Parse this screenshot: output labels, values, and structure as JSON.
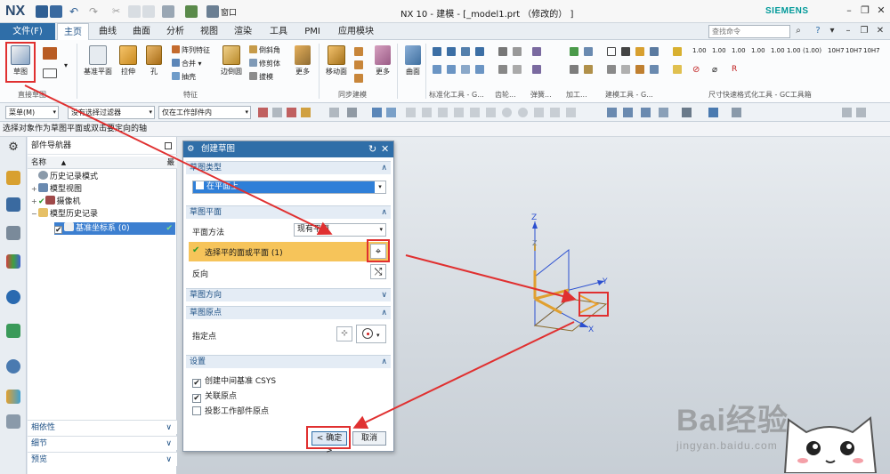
{
  "app": {
    "logo": "NX",
    "window_title": "NX 10 - 建模 - [_model1.prt （修改的） ]",
    "brand": "SIEMENS",
    "brand_color": "#009999",
    "accent_color": "#2f6ea8"
  },
  "quick_access": {
    "window_menu": "窗口"
  },
  "window_buttons": {
    "minimize": "–",
    "restore": "❐",
    "close": "✕"
  },
  "menu": {
    "file": "文件(F)",
    "tabs": [
      "主页",
      "曲线",
      "曲面",
      "分析",
      "视图",
      "渲染",
      "工具",
      "PMI",
      "应用模块"
    ],
    "active_tab": 0,
    "search_placeholder": "查找命令"
  },
  "ribbon": {
    "sketch": "草图",
    "datum_plane": "基准平面",
    "extrude": "拉伸",
    "hole": "孔",
    "pattern_feature": "阵列特征",
    "unite": "合并",
    "shell": "抽壳",
    "edge_blend": "边倒圆",
    "chamfer": "倒斜角",
    "trim_body": "修剪体",
    "draft": "拔模",
    "more": "更多",
    "move_face": "移动面",
    "surface": "曲面",
    "groups": {
      "direct_sketch": "直接草图",
      "feature": "特征",
      "sync_modeling": "同步建模",
      "standard_tools": "标准化工具 - G...",
      "gear": "齿轮...",
      "spring": "弹簧...",
      "machining": "加工...",
      "modeling_tools": "建模工具 - G...",
      "dimension_tools": "尺寸快速格式化工具 - GC工具箱"
    },
    "dim_labels": [
      "1.00",
      "1.00",
      "1.00",
      "1.00",
      "1.00",
      "1.00",
      "(1.00)",
      "10H7",
      "10H7",
      "10H7"
    ]
  },
  "selbar": {
    "menu": "菜单(M)",
    "filter": "没有选择过滤器",
    "scope": "仅在工作部件内"
  },
  "cue": "选择对象作为草图平面或双击要定向的轴",
  "navigator": {
    "title": "部件导航器",
    "columns": {
      "name": "名称",
      "latest": "最"
    },
    "nodes": [
      "历史记录模式",
      "模型视图",
      "摄像机",
      "模型历史记录",
      "基准坐标系 (0)"
    ],
    "bottom_panels": [
      "相依性",
      "细节",
      "预览"
    ]
  },
  "dialog": {
    "title": "创建草图",
    "sketch_type_section": "草图类型",
    "sketch_type_value": "在平面上",
    "sketch_plane_section": "草图平面",
    "plane_method_label": "平面方法",
    "plane_method_value": "现有平面",
    "select_plane": "选择平的面或平面 (1)",
    "reverse": "反向",
    "sketch_orientation_section": "草图方向",
    "sketch_origin_section": "草图原点",
    "specify_point": "指定点",
    "settings_section": "设置",
    "options": [
      {
        "label": "创建中间基准 CSYS",
        "checked": true
      },
      {
        "label": "关联原点",
        "checked": true
      },
      {
        "label": "投影工作部件原点",
        "checked": false
      }
    ],
    "ok": "< 确定 >",
    "cancel": "取消"
  },
  "viewport": {
    "axes": {
      "x": "X",
      "y": "Y",
      "z": "Z"
    }
  },
  "watermark": {
    "main": "Bai经验",
    "sub": "jingyan.baidu.com"
  }
}
